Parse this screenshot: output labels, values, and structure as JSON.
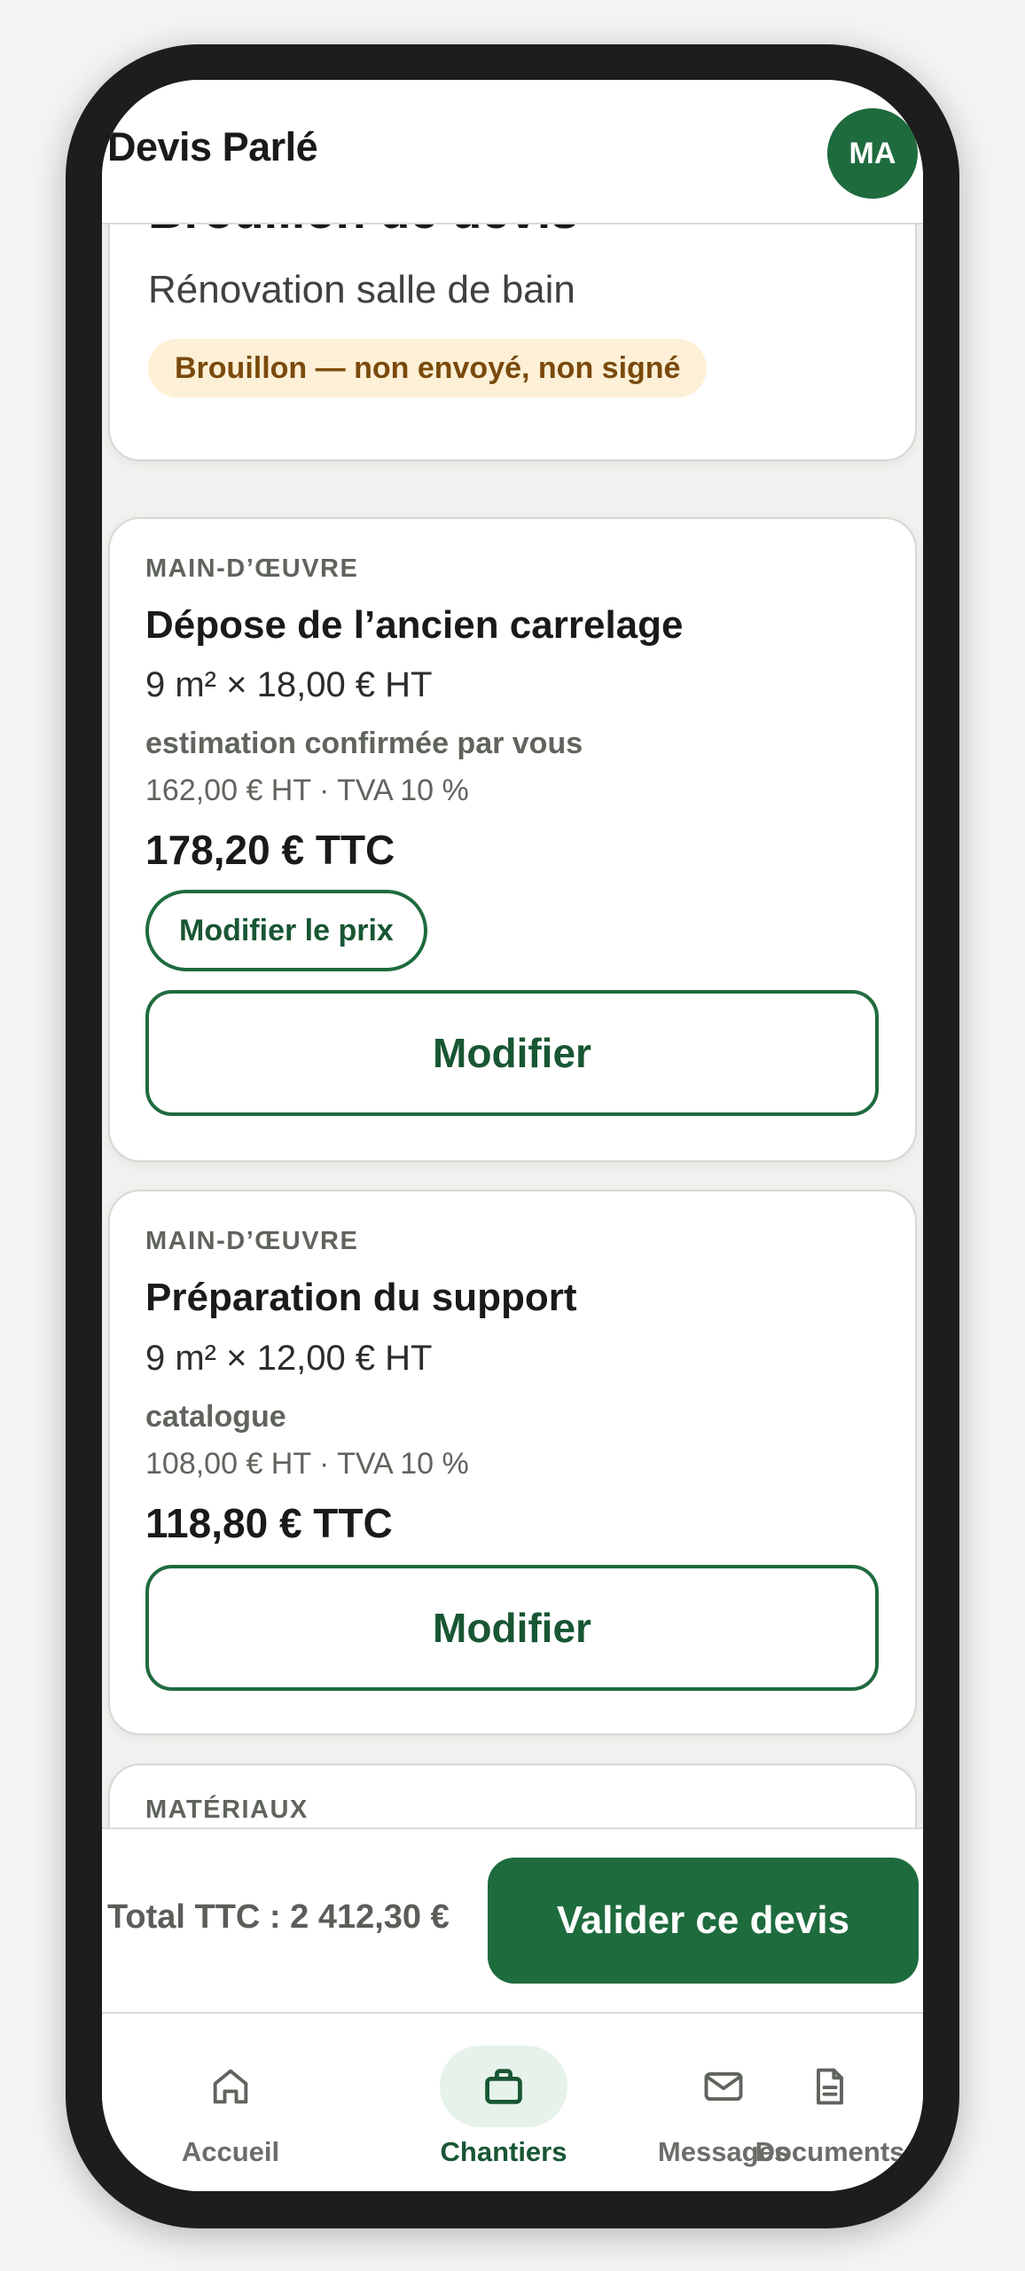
{
  "header": {
    "app_title": "Devis Parlé",
    "avatar_initials": "MA"
  },
  "summary": {
    "title": "Brouillon de devis",
    "project": "Rénovation salle de bain",
    "status_badge": "Brouillon — non envoyé, non signé"
  },
  "lines": [
    {
      "category": "MAIN-D’ŒUVRE",
      "title": "Dépose de l’ancien carrelage",
      "quantity_price": "9 m² × 18,00 € HT",
      "source": "estimation confirmée par vous",
      "ht_tva": "162,00 € HT · TVA 10 %",
      "ttc": "178,20 € TTC",
      "edit_price_label": "Modifier le prix",
      "edit_label": "Modifier"
    },
    {
      "category": "MAIN-D’ŒUVRE",
      "title": "Préparation du support",
      "quantity_price": "9 m² × 12,00 € HT",
      "source": "catalogue",
      "ht_tva": "108,00 € HT · TVA 10 %",
      "ttc": "118,80 € TTC",
      "edit_label": "Modifier"
    },
    {
      "category": "MATÉRIAUX"
    }
  ],
  "footer": {
    "total": "Total TTC : 2 412,30 €",
    "validate_label": "Valider ce devis"
  },
  "nav": {
    "active": "Chantiers",
    "items": [
      {
        "label": "Accueil",
        "icon": "home-icon"
      },
      {
        "label": "Chantiers",
        "icon": "briefcase-icon"
      },
      {
        "label": "Messages",
        "icon": "mail-icon"
      },
      {
        "label": "Documents",
        "icon": "document-icon"
      }
    ]
  },
  "colors": {
    "primary": "#1e6b3e",
    "badge_bg": "#fdf0d6",
    "badge_text": "#7a4a0c",
    "active_nav_bg": "#e6f2ea"
  }
}
